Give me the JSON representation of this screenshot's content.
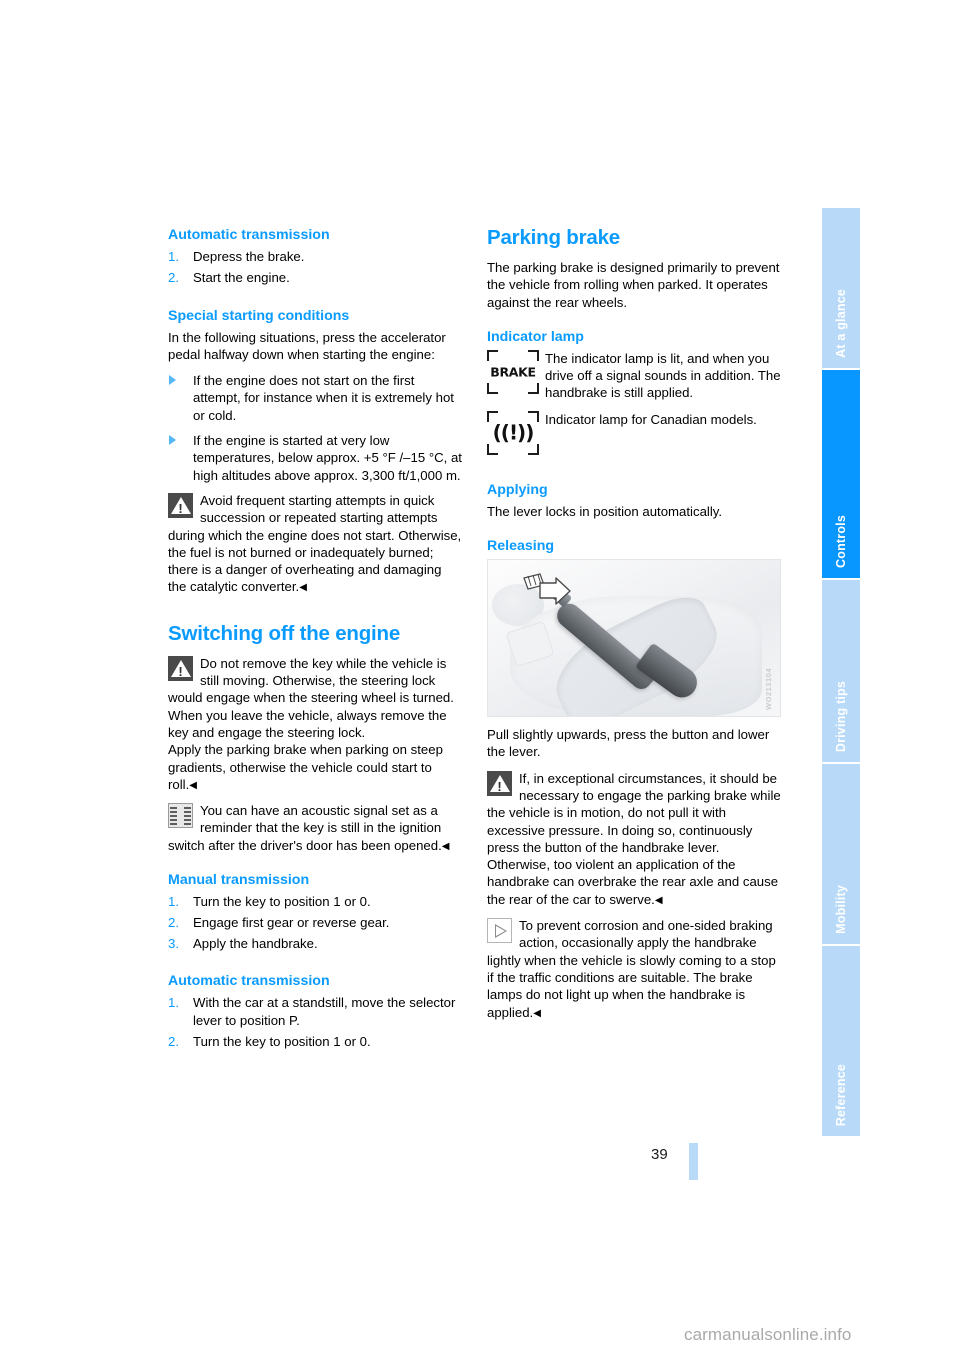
{
  "page": {
    "number": "39",
    "footer_watermark": "carmanualsonline.info"
  },
  "tabs": [
    {
      "label": "At a glance",
      "active": false
    },
    {
      "label": "Controls",
      "active": true
    },
    {
      "label": "Driving tips",
      "active": false
    },
    {
      "label": "Mobility",
      "active": false
    },
    {
      "label": "Reference",
      "active": false
    }
  ],
  "colors": {
    "accent": "#0a9bff",
    "tab_active": "#0896ff",
    "tab_inactive": "#b8daf8"
  },
  "left_column": {
    "auto_trans_1": {
      "heading": "Automatic transmission",
      "steps": [
        {
          "num": "1.",
          "text": "Depress the brake."
        },
        {
          "num": "2.",
          "text": "Start the engine."
        }
      ]
    },
    "special_starting": {
      "heading": "Special starting conditions",
      "intro": "In the following situations, press the accelerator pedal halfway down when starting the engine:",
      "bullets": [
        "If the engine does not start on the first attempt, for instance when it is extremely hot or cold.",
        "If the engine is started at very low temperatures, below approx. +5 °F /–15 °C, at high altitudes above approx. 3,300 ft/1,000 m."
      ],
      "warning": "Avoid frequent starting attempts in quick succession or repeated starting attempts during which the engine does not start. Otherwise, the fuel is not burned or inadequately burned; there is a danger of overheating and damaging the catalytic converter.",
      "warning_icon": "warning-triangle-icon",
      "endmark": "◀"
    },
    "switching_off": {
      "heading": "Switching off the engine",
      "warning": "Do not remove the key while the vehicle is still moving. Otherwise, the steering lock would engage when the steering wheel is turned.",
      "warning_icon": "warning-triangle-icon",
      "body_1": "When you leave the vehicle, always remove the key and engage the steering lock.",
      "body_2": "Apply the parking brake when parking on steep gradients, otherwise the vehicle could start to roll.",
      "note": "You can have an acoustic signal set as a reminder that the key is still in the ignition switch after the driver's door has been opened.",
      "note_icon": "acoustic-signal-person-icon",
      "endmark": "◀"
    },
    "manual_trans": {
      "heading": "Manual transmission",
      "steps": [
        {
          "num": "1.",
          "text": "Turn the key to position 1 or 0."
        },
        {
          "num": "2.",
          "text": "Engage first gear or reverse gear."
        },
        {
          "num": "3.",
          "text": "Apply the handbrake."
        }
      ]
    },
    "auto_trans_2": {
      "heading": "Automatic transmission",
      "steps": [
        {
          "num": "1.",
          "text": "With the car at a standstill, move the selector lever to position P."
        },
        {
          "num": "2.",
          "text": "Turn the key to position 1 or 0."
        }
      ]
    }
  },
  "right_column": {
    "parking_brake": {
      "heading": "Parking brake",
      "intro": "The parking brake is designed primarily to prevent the vehicle from rolling when parked. It operates against the rear wheels."
    },
    "indicator_lamp": {
      "heading": "Indicator lamp",
      "lamp_us": {
        "icon": "brake-indicator-lamp-icon",
        "glyph": "BRAKE",
        "text": "The indicator lamp is lit, and when you drive off a signal sounds in addition. The handbrake is still applied."
      },
      "lamp_ca": {
        "icon": "canadian-brake-indicator-lamp-icon",
        "glyph": "((!))",
        "text": "Indicator lamp for Canadian models."
      }
    },
    "applying": {
      "heading": "Applying",
      "text": "The lever locks in position automatically."
    },
    "releasing": {
      "heading": "Releasing",
      "figure": {
        "name": "handbrake-lever-photo",
        "watermark": "WO213104",
        "alt": "Center console handbrake lever with arrow pointing to release button"
      },
      "caption": "Pull slightly upwards, press the button and lower the lever.",
      "warning": "If, in exceptional circumstances, it should be necessary to engage the parking brake while the vehicle is in motion, do not pull it with excessive pressure. In doing so, continuously press the button of the handbrake lever. Otherwise, too violent an application of the handbrake can overbrake the rear axle and cause the rear of the car to swerve.",
      "warning_icon": "warning-triangle-icon",
      "note": "To prevent corrosion and one-sided braking action, occasionally apply the handbrake lightly when the vehicle is slowly coming to a stop if the traffic conditions are suitable. The brake lamps do not light up when the handbrake is applied.",
      "note_icon": "note-triangle-icon",
      "endmark": "◀"
    }
  }
}
